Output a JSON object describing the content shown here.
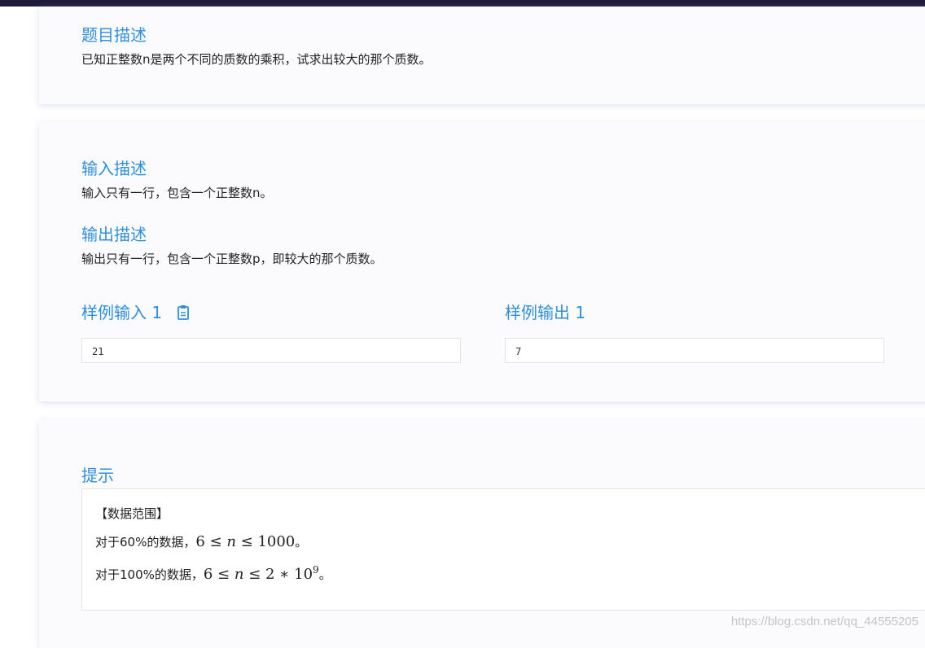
{
  "problem": {
    "title": "题目描述",
    "text": "已知正整数n是两个不同的质数的乘积，试求出较大的那个质数。"
  },
  "input": {
    "title": "输入描述",
    "text": "输入只有一行，包含一个正整数n。"
  },
  "output": {
    "title": "输出描述",
    "text": "输出只有一行，包含一个正整数p，即较大的那个质数。"
  },
  "samples": {
    "input_title": "样例输入 1",
    "input_value": "21",
    "output_title": "样例输出 1",
    "output_value": "7",
    "copy_icon": "clipboard-icon"
  },
  "hint": {
    "title": "提示",
    "range_label": "【数据范围】",
    "line1_prefix": "对于60%的数据，",
    "line1_low": "6",
    "line1_var": "n",
    "line1_high": "1000",
    "line1_end": "。",
    "line2_prefix": "对于100%的数据，",
    "line2_low": "6",
    "line2_var": "n",
    "line2_coef": "2",
    "line2_base": "10",
    "line2_exp": "9",
    "line2_end": "。"
  },
  "watermark": "https://blog.csdn.net/qq_44555205",
  "colors": {
    "accent": "#2f8fe0",
    "topbar": "#1e1a3a"
  }
}
